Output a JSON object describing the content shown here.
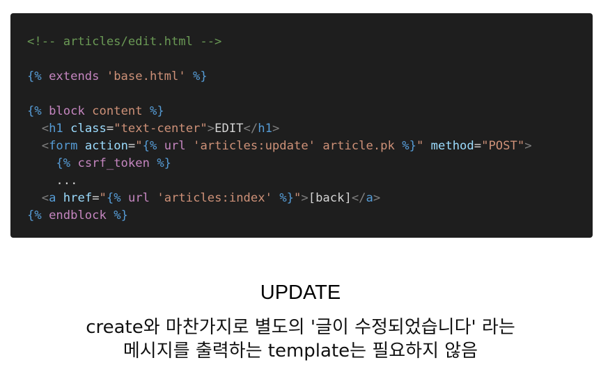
{
  "code": {
    "comment": "<!-- articles/edit.html -->",
    "extends_open": "{%",
    "extends_kw": "extends",
    "extends_val": "'base.html'",
    "extends_close": "%}",
    "block_open": "{%",
    "block_kw": "block",
    "block_name": "content",
    "block_close": "%}",
    "h1_lt": "<",
    "h1_tag": "h1",
    "h1_attr": "class",
    "h1_eq": "=",
    "h1_val": "\"text-center\"",
    "h1_gt": ">",
    "h1_text": "EDIT",
    "h1_close_lt": "</",
    "h1_close_tag": "h1",
    "h1_close_gt": ">",
    "form_lt": "<",
    "form_tag": "form",
    "form_attr1": "action",
    "form_eq1": "=",
    "form_q1": "\"",
    "form_tpl_open": "{%",
    "form_tpl_kw": "url",
    "form_tpl_str": "'articles:update'",
    "form_tpl_var": "article.pk",
    "form_tpl_close": "%}",
    "form_q2": "\"",
    "form_attr2": "method",
    "form_eq2": "=",
    "form_val2": "\"POST\"",
    "form_gt": ">",
    "csrf_open": "{%",
    "csrf_kw": "csrf_token",
    "csrf_close": "%}",
    "ellipsis": "...",
    "a_lt": "<",
    "a_tag": "a",
    "a_attr": "href",
    "a_eq": "=",
    "a_q1": "\"",
    "a_tpl_open": "{%",
    "a_tpl_kw": "url",
    "a_tpl_str": "'articles:index'",
    "a_tpl_close": "%}",
    "a_q2": "\"",
    "a_gt": ">",
    "a_text": "[back]",
    "a_close_lt": "</",
    "a_close_tag": "a",
    "a_close_gt": ">",
    "end_open": "{%",
    "end_kw": "endblock",
    "end_close": "%}"
  },
  "title": "UPDATE",
  "description": {
    "line1": "create와 마찬가지로 별도의 '글이 수정되었습니다' 라는",
    "line2": "메시지를 출력하는 template는 필요하지 않음"
  },
  "colors": {
    "code_background": "#1e1e1e",
    "comment": "#6a9955",
    "template_delimiter": "#569cd6",
    "keyword": "#c586c0",
    "string": "#ce9178",
    "html_tag": "#569cd6",
    "attribute": "#9cdcfe"
  }
}
